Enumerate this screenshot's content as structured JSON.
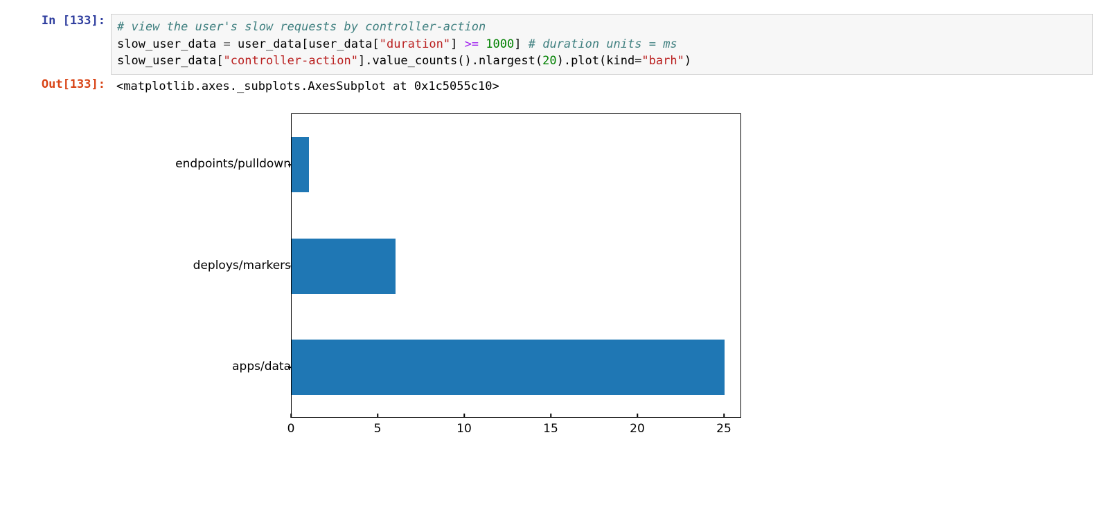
{
  "input_prompt": "In [133]:",
  "output_prompt": "Out[133]:",
  "code": {
    "line1_comment": "# view the user's slow requests by controller-action",
    "l2_a": "slow_user_data ",
    "l2_eq": "=",
    "l2_b": " user_data[user_data[",
    "l2_str1": "\"duration\"",
    "l2_c": "] ",
    "l2_cmp": ">=",
    "l2_sp": " ",
    "l2_num": "1000",
    "l2_d": "] ",
    "l2_comment": "# duration units = ms",
    "l3_a": "slow_user_data[",
    "l3_str": "\"controller-action\"",
    "l3_b": "].value_counts().nlargest(",
    "l3_num": "20",
    "l3_c": ").plot(kind=",
    "l3_str2": "\"barh\"",
    "l3_d": ")"
  },
  "output_text": "<matplotlib.axes._subplots.AxesSubplot at 0x1c5055c10>",
  "chart_data": {
    "type": "bar",
    "orientation": "horizontal",
    "categories": [
      "apps/data",
      "deploys/markers",
      "endpoints/pulldown"
    ],
    "values": [
      25,
      6,
      1
    ],
    "xlim": [
      0,
      26
    ],
    "xticks": [
      0,
      5,
      10,
      15,
      20,
      25
    ],
    "title": "",
    "xlabel": "",
    "ylabel": ""
  }
}
